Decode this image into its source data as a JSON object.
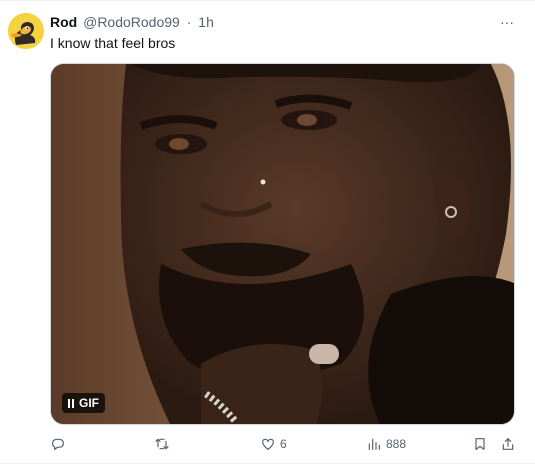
{
  "tweet": {
    "author_name": "Rod",
    "author_handle": "@RodoRodo99",
    "separator": "·",
    "time": "1h",
    "more_label": "···",
    "text": "I know that feel bros"
  },
  "media": {
    "badge_label": "GIF"
  },
  "actions": {
    "reply_count": "",
    "retweet_count": "",
    "like_count": "6",
    "views_count": "888"
  },
  "icons": {
    "reply": "reply-icon",
    "retweet": "retweet-icon",
    "like": "heart-icon",
    "views": "views-icon",
    "bookmark": "bookmark-icon",
    "share": "share-icon"
  }
}
